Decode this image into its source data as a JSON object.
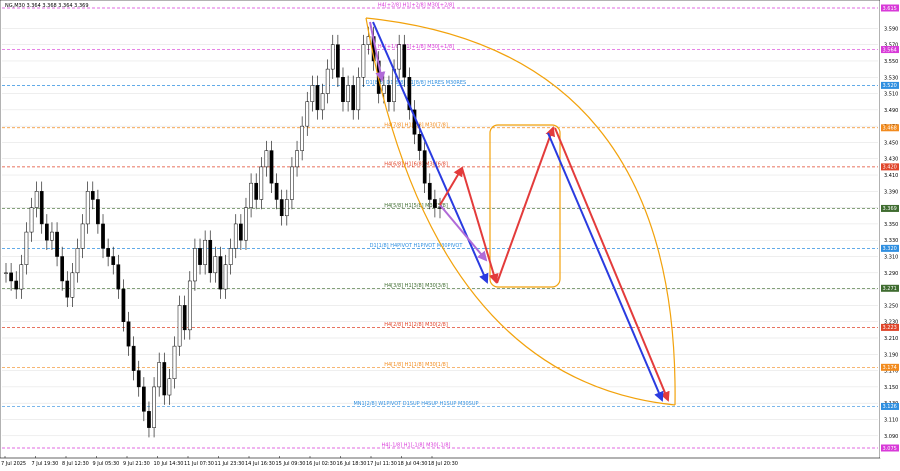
{
  "header": {
    "symbol_info": "NG,M30  3.364 3.368 3.364 3.369"
  },
  "colors": {
    "candle": "#000000",
    "blue_arrow": "#2a3be0",
    "red_arrow": "#e33b3b",
    "purple_arrow": "#b06ad8",
    "orange_shape": "#f2a20c",
    "grid": "#c8c8c8"
  },
  "chart_data": {
    "type": "candlestick",
    "ylim": [
      3.075,
      3.615
    ],
    "y_ticks": [
      "3.590",
      "3.570",
      "3.550",
      "3.530",
      "3.510",
      "3.490",
      "3.470",
      "3.450",
      "3.430",
      "3.410",
      "3.390",
      "3.370",
      "3.350",
      "3.330",
      "3.310",
      "3.290",
      "3.270",
      "3.250",
      "3.230",
      "3.210",
      "3.190",
      "3.170",
      "3.150",
      "3.130",
      "3.110",
      "3.090"
    ],
    "x_labels": [
      "7 Jul 2025",
      "7 Jul 19:30",
      "8 Jul 12:30",
      "9 Jul 05:30",
      "9 Jul 21:30",
      "10 Jul 14:30",
      "11 Jul 07:30",
      "11 Jul 23:30",
      "14 Jul 16:30",
      "15 Jul 09:30",
      "16 Jul 02:30",
      "16 Jul 18:30",
      "17 Jul 11:30",
      "18 Jul 04:30",
      "18 Jul 20:30"
    ],
    "closes": [
      3.29,
      3.28,
      3.27,
      3.3,
      3.34,
      3.37,
      3.39,
      3.35,
      3.33,
      3.34,
      3.31,
      3.28,
      3.26,
      3.29,
      3.32,
      3.35,
      3.39,
      3.38,
      3.35,
      3.32,
      3.31,
      3.3,
      3.27,
      3.23,
      3.2,
      3.17,
      3.15,
      3.12,
      3.1,
      3.15,
      3.18,
      3.14,
      3.16,
      3.2,
      3.25,
      3.22,
      3.28,
      3.32,
      3.3,
      3.33,
      3.29,
      3.31,
      3.27,
      3.3,
      3.32,
      3.35,
      3.33,
      3.37,
      3.4,
      3.38,
      3.42,
      3.44,
      3.4,
      3.38,
      3.36,
      3.38,
      3.42,
      3.44,
      3.47,
      3.5,
      3.52,
      3.49,
      3.51,
      3.54,
      3.57,
      3.53,
      3.5,
      3.52,
      3.49,
      3.53,
      3.57,
      3.58,
      3.55,
      3.51,
      3.52,
      3.5,
      3.54,
      3.57,
      3.53,
      3.49,
      3.46,
      3.44,
      3.4,
      3.38,
      3.37,
      3.369
    ],
    "levels": [
      {
        "label": "H4[+2/8] H1[+2/8] M30[+2/8]",
        "value": 3.615,
        "color": "#d83ad8",
        "badge": "3.615"
      },
      {
        "label": "H4[+1/8] H1[+1/8] M30[+1/8]",
        "value": 3.564,
        "color": "#d83ad8",
        "badge": "3.564"
      },
      {
        "label": "D1[8/8] D1[8/8] H1[8/8] H1RES M30RES",
        "value": 3.52,
        "color": "#2f8fe0",
        "badge": "3.520"
      },
      {
        "label": "H4[7/8] H1[7/8] M30[7/8]",
        "value": 3.468,
        "color": "#f28b1e",
        "badge": "3.468"
      },
      {
        "label": "H4[6/8] H1[6/8] M30[6/8]",
        "value": 3.42,
        "color": "#e0452a",
        "badge": "3.420"
      },
      {
        "label": "H4[5/8] H1[5/8] M30[5/8]",
        "value": 3.369,
        "color": "#3f6c30",
        "badge": "3.369"
      },
      {
        "label": "D1[1/8] H4PIVOT H1PIVOT M30PIVOT",
        "value": 3.32,
        "color": "#2f8fe0",
        "badge": "3.320"
      },
      {
        "label": "H4[3/8] H1[3/8] M30[3/8]",
        "value": 3.271,
        "color": "#3f6c30",
        "badge": "3.271"
      },
      {
        "label": "H4[2/8] H1[2/8] M30[2/8]",
        "value": 3.223,
        "color": "#e0452a",
        "badge": "3.223"
      },
      {
        "label": "H4[1/8] H1[1/8] M30[1/8]",
        "value": 3.174,
        "color": "#f28b1e",
        "badge": "3.174"
      },
      {
        "label": "MN1[2/8] W1PIVOT D1SUP H4SUP H1SUP M30SUP",
        "value": 3.126,
        "color": "#2f8fe0",
        "badge": "3.126"
      },
      {
        "label": "H4[-1/8] H1[-1/8] M30[-1/8]",
        "value": 3.075,
        "color": "#d83ad8",
        "badge": "3.075"
      }
    ]
  }
}
